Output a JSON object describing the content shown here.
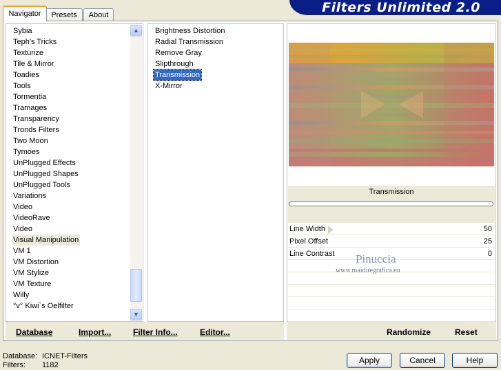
{
  "tabs": [
    {
      "label": "Navigator"
    },
    {
      "label": "Presets"
    },
    {
      "label": "About"
    }
  ],
  "banner": {
    "title": "Filters Unlimited 2.0"
  },
  "categories": {
    "items": [
      "Sybia",
      "Teph's Tricks",
      "Texturize",
      "Tile & Mirror",
      "Toadies",
      "Tools",
      "Tormentia",
      "Tramages",
      "Transparency",
      "Tronds Filters",
      "Two Moon",
      "Tymoes",
      "UnPlugged Effects",
      "UnPlugged Shapes",
      "UnPlugged Tools",
      "Variations",
      "Video",
      "VideoRave",
      "Video",
      "Visual Manipulation",
      "VM 1",
      "VM Distortion",
      "VM Stylize",
      "VM Texture",
      "Willy",
      "°v° Kiwi`s Oelfilter"
    ],
    "selected": "Visual Manipulation"
  },
  "filters": {
    "items": [
      "Brightness Distortion",
      "Radial Transmission",
      "Remove Gray",
      "Slipthrough",
      "Transmission",
      "X-Mirror"
    ],
    "selected": "Transmission"
  },
  "left_actions": {
    "database": "Database",
    "import": "Import...",
    "filter_info": "Filter Info...",
    "editor": "Editor..."
  },
  "preview": {
    "filter_name": "Transmission"
  },
  "params": [
    {
      "label": "Line Width",
      "value": "50"
    },
    {
      "label": "Pixel Offset",
      "value": "25"
    },
    {
      "label": "Line Contrast",
      "value": "0"
    }
  ],
  "watermark": {
    "name": "Pinuccia",
    "url": "www.maidiregrafica.eu"
  },
  "right_actions": {
    "randomize": "Randomize",
    "reset": "Reset"
  },
  "status": {
    "database_label": "Database:",
    "database_value": "ICNET-Filters",
    "filters_label": "Filters:",
    "filters_value": "1182"
  },
  "dialog_buttons": {
    "apply": "Apply",
    "cancel": "Cancel",
    "help": "Help"
  },
  "colors": {
    "banner": "#0a1e88",
    "selection": "#316ac5",
    "tab_accent": "#f5a623"
  }
}
